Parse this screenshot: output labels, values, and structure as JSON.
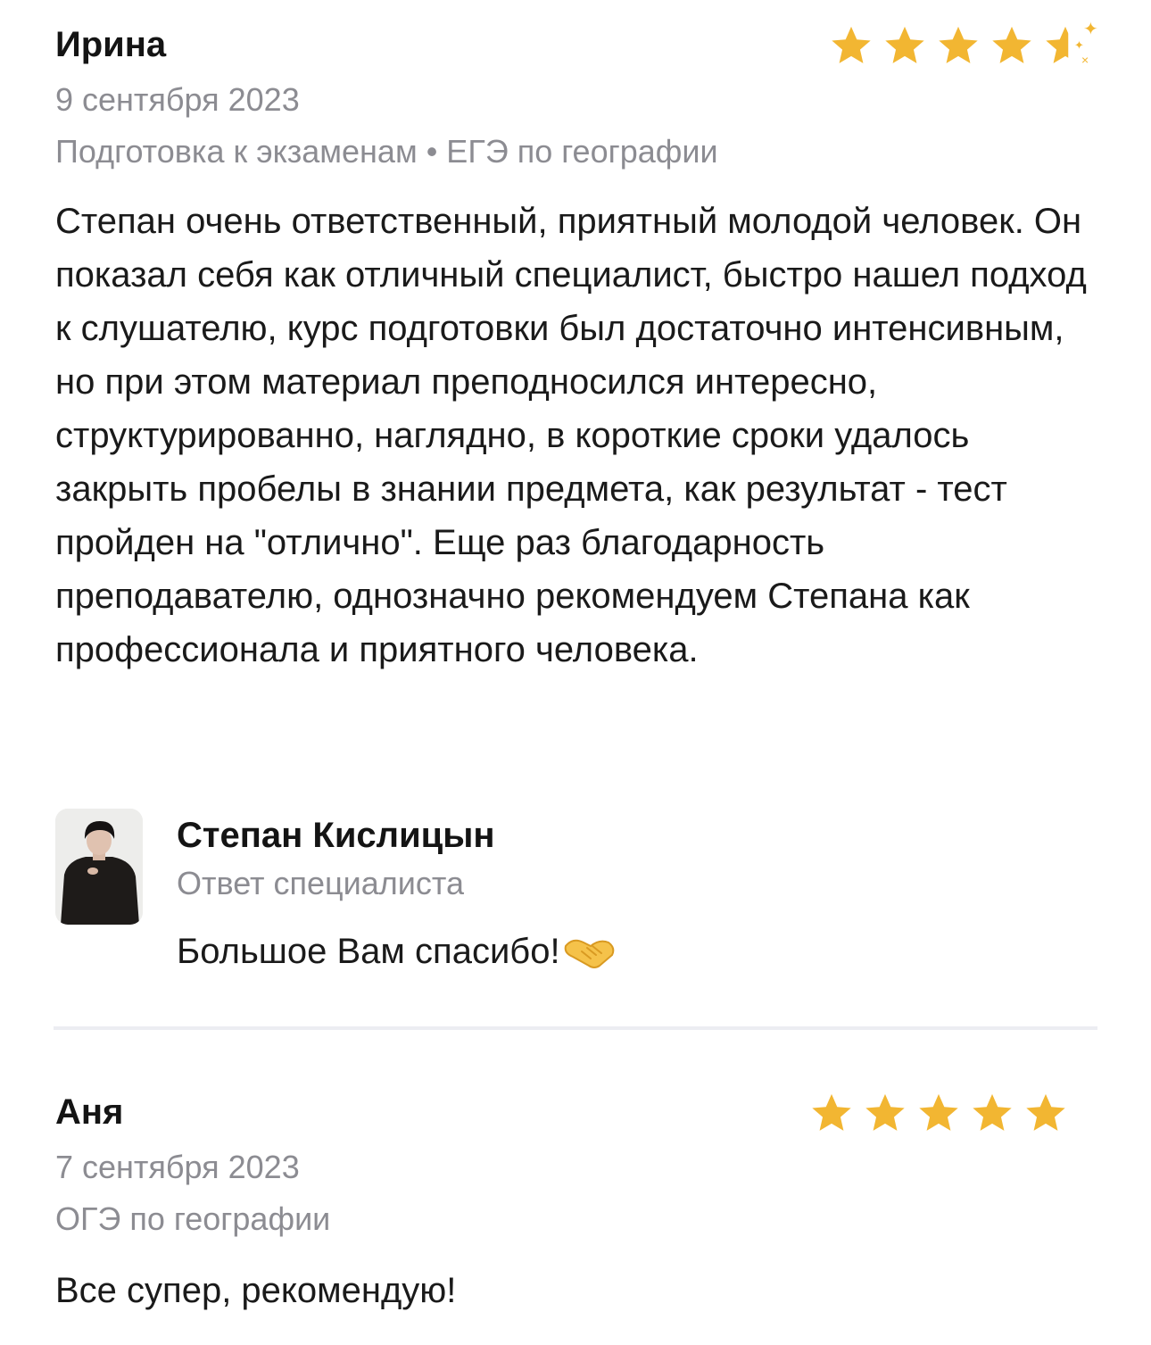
{
  "reviews": [
    {
      "name": "Ирина",
      "date": "9 сентября 2023",
      "category": "Подготовка к экзаменам • ЕГЭ по географии",
      "rating": 4.5,
      "text": "Степан очень ответственный, приятный молодой человек. Он показал себя как отличный специалист, быстро нашел подход к слушателю, курс подготовки был достаточно интенсивным, но при этом материал преподносился интересно, структурированно, наглядно, в короткие сроки удалось закрыть пробелы в знании предмета, как результат - тест пройден на \"отлично\". Еще раз благодарность преподавателю, однозначно рекомендуем Степана как профессионала и приятного человека."
    },
    {
      "name": "Аня",
      "date": "7 сентября 2023",
      "category": "ОГЭ по географии",
      "rating": 5,
      "text": "Все супер, рекомендую!"
    }
  ],
  "reply": {
    "specialist_name": "Степан Кислицын",
    "role": "Ответ специалиста",
    "text": "Большое Вам спасибо!",
    "icon": "handshake-icon"
  },
  "colors": {
    "star": "#f2b632",
    "muted_text": "#8c8c92",
    "divider": "#ecedf2"
  }
}
